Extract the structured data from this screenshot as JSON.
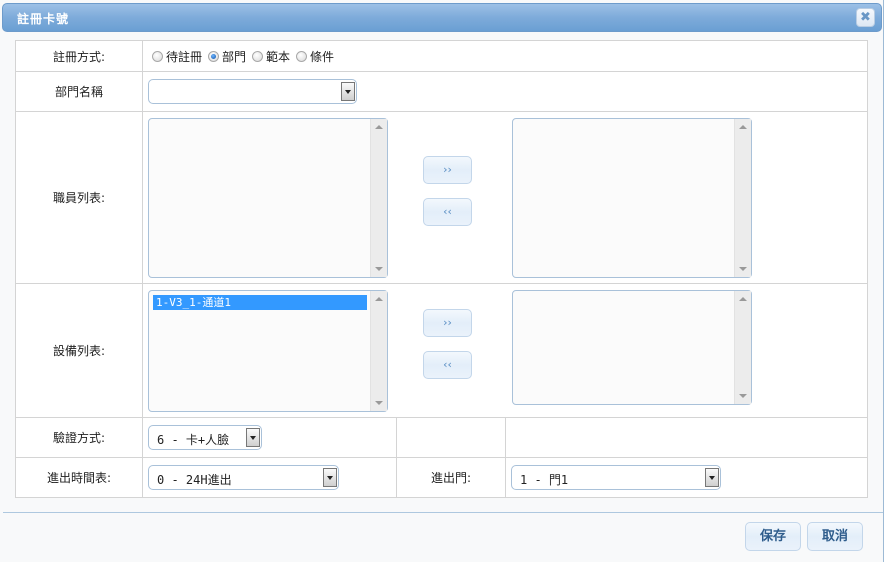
{
  "dialog": {
    "title": "註冊卡號",
    "close_icon": "close-icon"
  },
  "form": {
    "register_mode": {
      "label": "註冊方式:",
      "options": [
        {
          "label": "待註冊",
          "selected": false
        },
        {
          "label": "部門",
          "selected": true
        },
        {
          "label": "範本",
          "selected": false
        },
        {
          "label": "條件",
          "selected": false
        }
      ]
    },
    "department": {
      "label": "部門名稱",
      "value": ""
    },
    "employee_list": {
      "label": "職員列表:",
      "available": [],
      "selected": [],
      "add_label": "››",
      "remove_label": "‹‹"
    },
    "device_list": {
      "label": "設備列表:",
      "available": [
        "1-V3_1-通道1"
      ],
      "selected": [],
      "add_label": "››",
      "remove_label": "‹‹"
    },
    "verify_mode": {
      "label": "驗證方式:",
      "value": "6 - 卡+人臉"
    },
    "schedule": {
      "label": "進出時間表:",
      "value": "0 - 24H進出"
    },
    "door": {
      "label": "進出門:",
      "value": "1 - 門1"
    }
  },
  "footer": {
    "save_label": "保存",
    "cancel_label": "取消"
  }
}
